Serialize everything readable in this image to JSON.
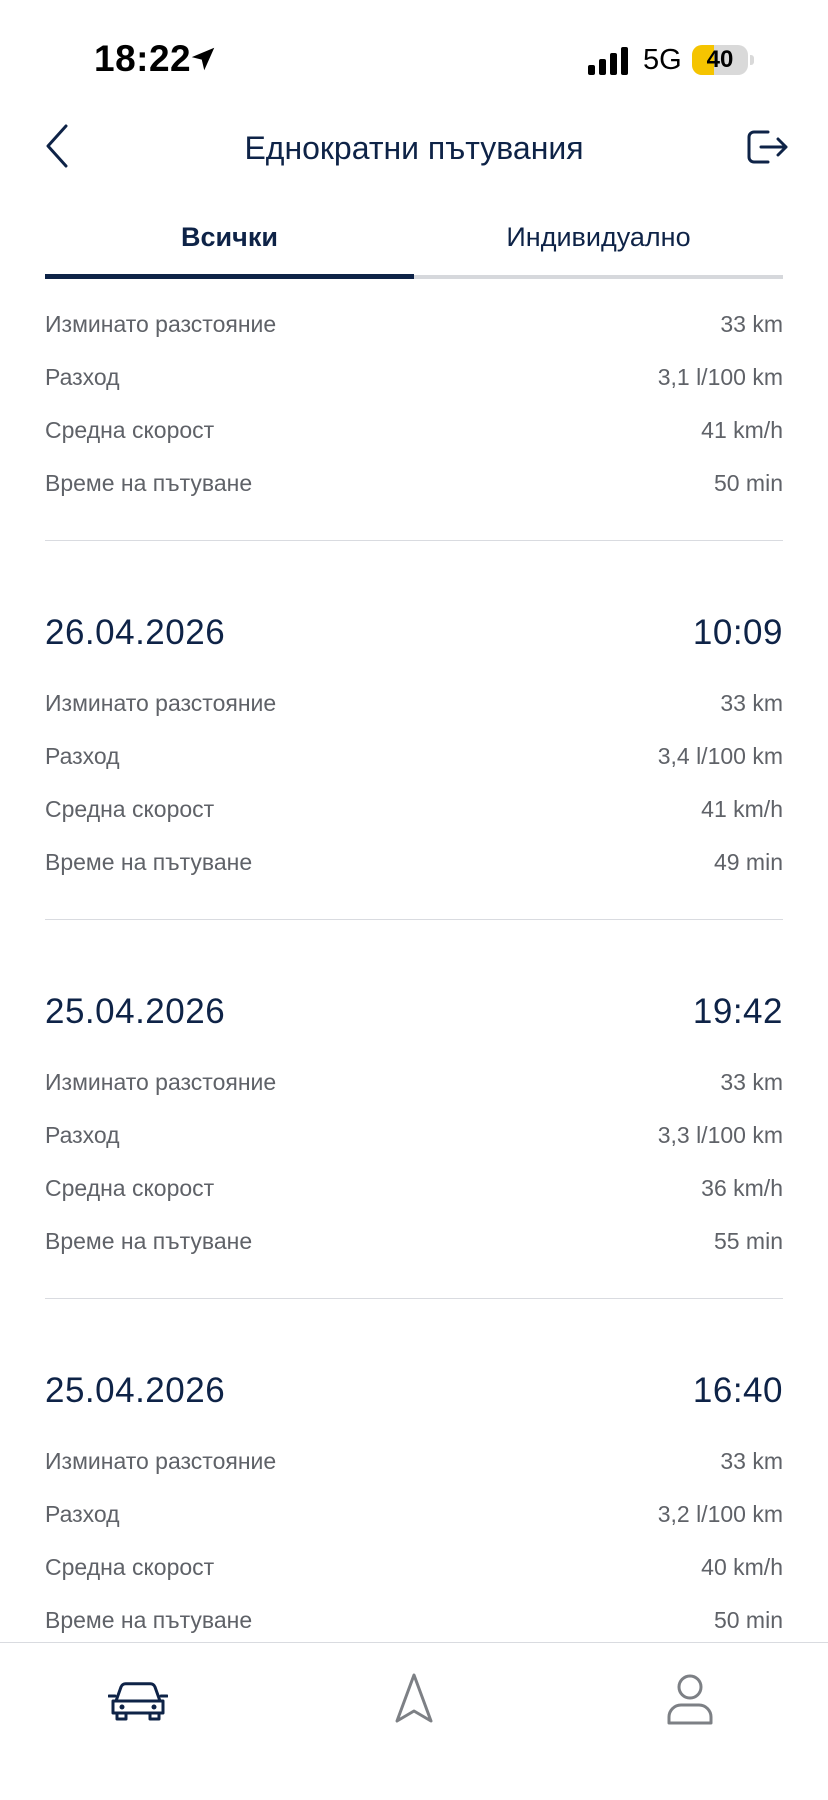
{
  "status_bar": {
    "time": "18:22",
    "network": "5G",
    "battery": "40",
    "battery_level": 0.4,
    "location_icon": "location-arrow-icon",
    "signal_icon": "signal-bars-icon"
  },
  "header": {
    "title": "Еднократни пътувания",
    "back_icon": "chevron-left-icon",
    "logout_icon": "logout-icon"
  },
  "tabs": [
    {
      "label": "Всички",
      "active": true
    },
    {
      "label": "Индивидуално",
      "active": false
    }
  ],
  "labels": {
    "distance": "Изминато разстояние",
    "consumption": "Разход",
    "avg_speed": "Средна скорост",
    "travel_time": "Време на пътуване"
  },
  "summary": {
    "distance": "33 km",
    "consumption": "3,1 l/100 km",
    "avg_speed": "41 km/h",
    "travel_time": "50 min"
  },
  "trips": [
    {
      "date": "26.04.2026",
      "time": "10:09",
      "distance": "33 km",
      "consumption": "3,4 l/100 km",
      "avg_speed": "41 km/h",
      "travel_time": "49 min"
    },
    {
      "date": "25.04.2026",
      "time": "19:42",
      "distance": "33 km",
      "consumption": "3,3 l/100 km",
      "avg_speed": "36 km/h",
      "travel_time": "55 min"
    },
    {
      "date": "25.04.2026",
      "time": "16:40",
      "distance": "33 km",
      "consumption": "3,2 l/100 km",
      "avg_speed": "40 km/h",
      "travel_time": "50 min"
    }
  ],
  "bottom_nav": [
    {
      "icon": "car-icon",
      "active": true
    },
    {
      "icon": "navigation-arrow-icon",
      "active": false
    },
    {
      "icon": "profile-icon",
      "active": false
    }
  ],
  "colors": {
    "primary": "#0e2347",
    "secondary_text": "#5f6268",
    "divider": "#d9dbe0",
    "battery": "#f5c400"
  }
}
